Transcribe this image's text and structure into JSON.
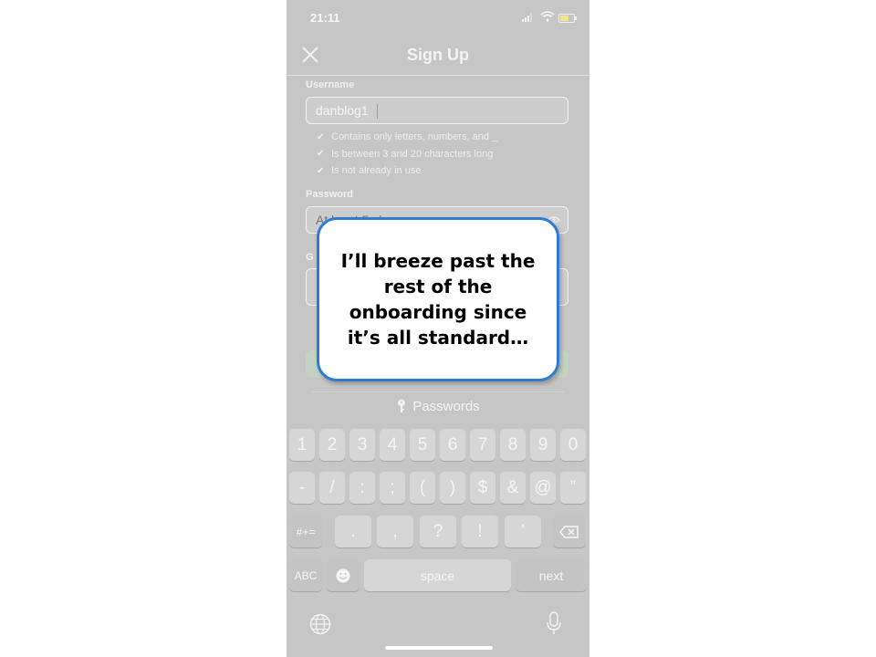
{
  "status_bar": {
    "time": "21:11"
  },
  "nav": {
    "title": "Sign Up"
  },
  "username": {
    "label": "Username",
    "value": "danblog1",
    "requirements": [
      "Contains only letters, numbers, and _",
      "Is between 3 and 20 characters long",
      "Is not already in use"
    ]
  },
  "password": {
    "label": "Password",
    "placeholder": "At least 5 char"
  },
  "hidden_section": {
    "label_fragment": "G"
  },
  "keyboard": {
    "passwords_label": "Passwords",
    "row1": [
      "1",
      "2",
      "3",
      "4",
      "5",
      "6",
      "7",
      "8",
      "9",
      "0"
    ],
    "row2": [
      "-",
      "/",
      ":",
      ";",
      "(",
      ")",
      "$",
      "&",
      "@",
      "”"
    ],
    "row3_symbols_key": "#+=",
    "row3": [
      ".",
      ",",
      "?",
      "!",
      "’"
    ],
    "abc_key": "ABC",
    "space_key": "space",
    "next_key": "next"
  },
  "callout": {
    "text": "I’ll breeze past the rest of the onboarding since it’s all standard…"
  },
  "colors": {
    "accent_border": "#2f7ad8",
    "overlay_gray": "#c6c6c6"
  }
}
